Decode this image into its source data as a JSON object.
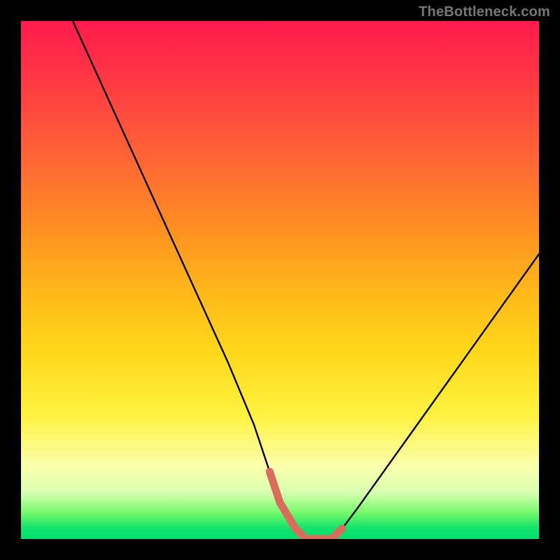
{
  "watermark": "TheBottleneck.com",
  "chart_data": {
    "type": "line",
    "title": "",
    "xlabel": "",
    "ylabel": "",
    "xlim": [
      0,
      100
    ],
    "ylim": [
      0,
      100
    ],
    "grid": false,
    "legend": false,
    "series": [
      {
        "name": "bottleneck-curve",
        "x": [
          10,
          15,
          20,
          25,
          30,
          35,
          40,
          45,
          48,
          50,
          53,
          55,
          58,
          60,
          62,
          65,
          70,
          75,
          80,
          85,
          90,
          95,
          100
        ],
        "y": [
          100,
          89,
          78,
          67,
          56,
          45,
          34,
          22,
          13,
          7,
          2,
          0,
          0,
          0,
          2,
          6,
          13,
          20,
          27,
          34,
          41,
          48,
          55
        ]
      }
    ],
    "trough_highlight": {
      "name": "optimal-range-marker",
      "color": "#d96c5d",
      "x": [
        48,
        50,
        53,
        55,
        58,
        60,
        62
      ],
      "y": [
        13,
        7,
        2,
        0,
        0,
        0,
        2
      ]
    },
    "background_gradient": {
      "orientation": "vertical",
      "stops": [
        {
          "pos": 0.0,
          "color": "#ff1a4e"
        },
        {
          "pos": 0.12,
          "color": "#ff3a44"
        },
        {
          "pos": 0.28,
          "color": "#ff6a33"
        },
        {
          "pos": 0.4,
          "color": "#ff8f22"
        },
        {
          "pos": 0.52,
          "color": "#ffb71a"
        },
        {
          "pos": 0.64,
          "color": "#ffd81a"
        },
        {
          "pos": 0.76,
          "color": "#fff240"
        },
        {
          "pos": 0.86,
          "color": "#fbffab"
        },
        {
          "pos": 0.91,
          "color": "#d8ffb0"
        },
        {
          "pos": 0.95,
          "color": "#74f76a"
        },
        {
          "pos": 0.98,
          "color": "#0fe26b"
        },
        {
          "pos": 1.0,
          "color": "#05e06e"
        }
      ]
    }
  }
}
